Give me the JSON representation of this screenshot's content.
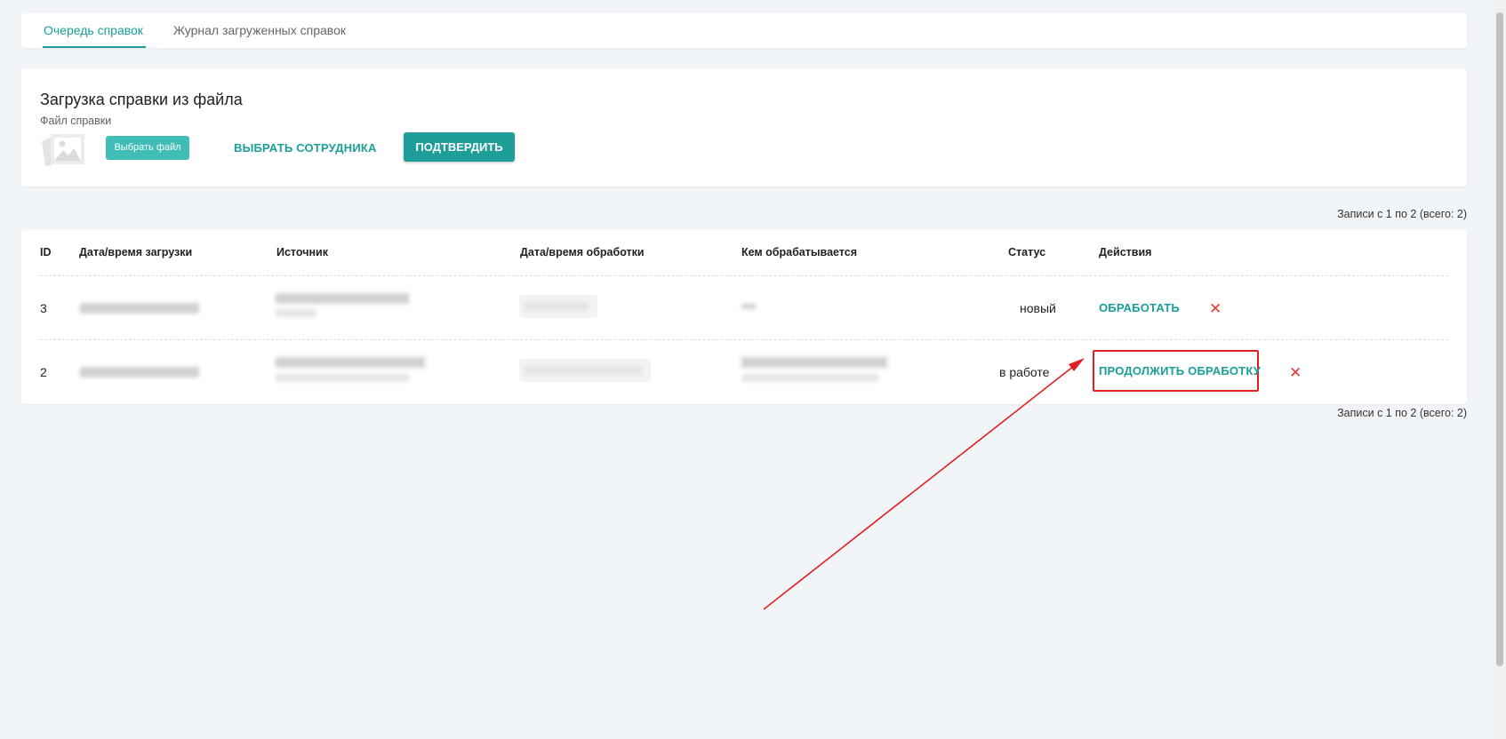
{
  "tabs": [
    {
      "label": "Очередь справок",
      "active": true
    },
    {
      "label": "Журнал загруженных справок",
      "active": false
    }
  ],
  "upload": {
    "title": "Загрузка справки из файла",
    "file_label": "Файл справки",
    "choose_file_label": "Выбрать файл",
    "select_employee_label": "ВЫБРАТЬ СОТРУДНИКА",
    "confirm_label": "ПОДТВЕРДИТЬ"
  },
  "records_info": "Записи с 1 по 2 (всего: 2)",
  "table": {
    "columns": [
      "ID",
      "Дата/время загрузки",
      "Источник",
      "Дата/время обработки",
      "Кем обрабатывается",
      "Статус",
      "Действия"
    ],
    "rows": [
      {
        "id": "3",
        "status": "новый",
        "action": "ОБРАБОТАТЬ"
      },
      {
        "id": "2",
        "status": "в работе",
        "action": "ПРОДОЛЖИТЬ ОБРАБОТКУ"
      }
    ]
  },
  "icons": {
    "file_placeholder": "image-placeholder-icon",
    "delete": "close-icon"
  },
  "colors": {
    "accent": "#1a9e9a",
    "delete": "#e53935",
    "annotation": "#e02020",
    "page_bg": "#f2f5f8"
  }
}
